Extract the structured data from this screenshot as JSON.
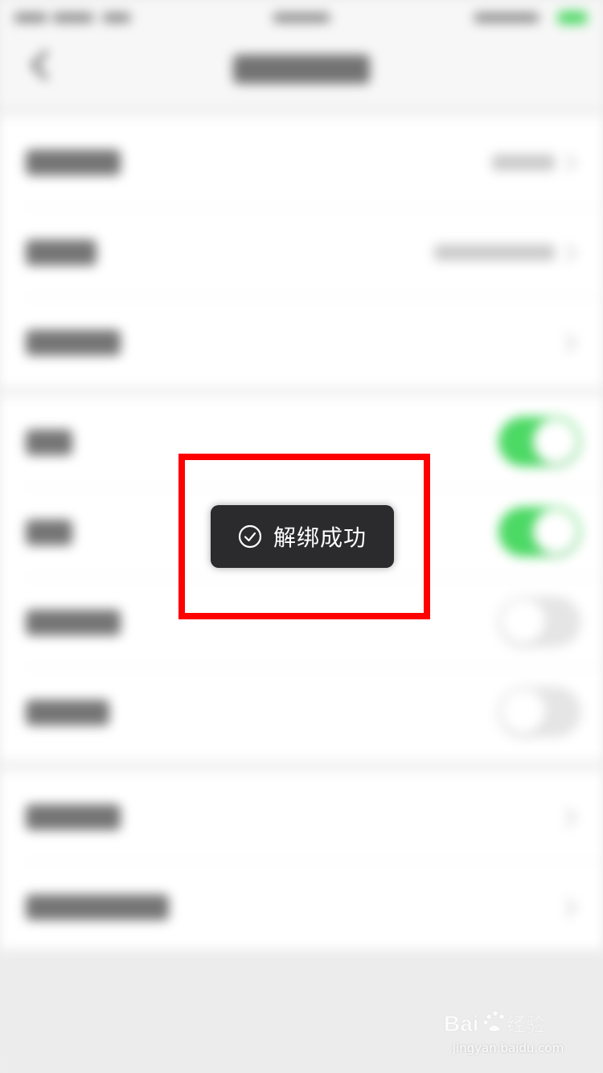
{
  "toast": {
    "icon": "check-circle-icon",
    "message": "解绑成功"
  },
  "settings": {
    "group1_rows": 3,
    "group2_toggles": [
      {
        "state": "on"
      },
      {
        "state": "on"
      },
      {
        "state": "off"
      },
      {
        "state": "off"
      }
    ],
    "group3_rows": 2
  },
  "watermark": {
    "brand": "Baidu经验",
    "url": "jingyan.baidu.com"
  },
  "colors": {
    "toggle_on": "#4cd964",
    "toast_bg": "#2b2b2d",
    "highlight": "#ff0000"
  }
}
